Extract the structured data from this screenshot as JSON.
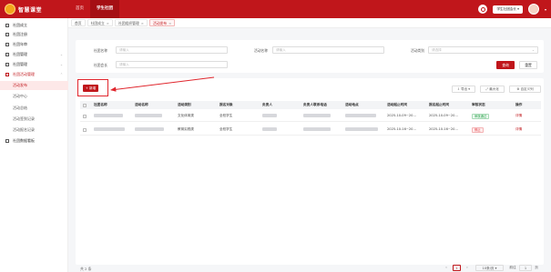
{
  "header": {
    "logo_text": "智慧课堂",
    "nav": [
      "首页",
      "学生社团"
    ],
    "unit_select": "学生社团会长",
    "colors": {
      "brand": "#c0161b",
      "accent": "#f3a51c"
    }
  },
  "sidebar": {
    "items": [
      {
        "label": "社团成立",
        "icon": "grid-icon"
      },
      {
        "label": "社团注册",
        "icon": "grid-icon"
      },
      {
        "label": "社团年审",
        "icon": "grid-icon"
      },
      {
        "label": "社团管理",
        "icon": "grid-icon"
      },
      {
        "label": "社团管理",
        "icon": "grid-icon"
      },
      {
        "label": "社团活动管理",
        "icon": "grid-icon"
      }
    ],
    "sub_items": [
      "活动发布",
      "活动中心",
      "活动总结",
      "活动签到记录",
      "活动报名记录"
    ],
    "last_item": "社团数据看板"
  },
  "tabs": [
    "首页",
    "社团成立",
    "社团组织管理",
    "活动发布"
  ],
  "filters": {
    "club_name_label": "社团名称",
    "club_name_placeholder": "请输入",
    "activity_name_label": "活动名称",
    "activity_name_placeholder": "请输入",
    "activity_type_label": "活动类别",
    "activity_type_placeholder": "请选择",
    "club_leader_label": "社团会长",
    "club_leader_placeholder": "请输入",
    "query_label": "查询",
    "reset_label": "重置"
  },
  "toolbar": {
    "new_label": "+ 新增",
    "export_label": "导出",
    "fullscreen_label": "最大化",
    "columns_label": "自定义列"
  },
  "table": {
    "columns": [
      "社团名称",
      "活动名称",
      "活动类别",
      "报名对象",
      "负责人",
      "负责人联系电话",
      "活动地点",
      "活动起止时间",
      "报名起止时间",
      "审核状态",
      "操作"
    ],
    "rows": [
      {
        "category": "文化体育类",
        "target": "全校学生",
        "start": "2025-10-09~20...",
        "signup": "2025-10-09~20...",
        "status": "审核通过",
        "action": "详情"
      },
      {
        "category": "教育实践类",
        "target": "全校学生",
        "start": "2025-10-16~20...",
        "signup": "2025-10-16~20...",
        "status": "停止",
        "action": "详情"
      }
    ]
  },
  "pagination": {
    "total": "共 2 条",
    "page": "1",
    "page_size": "10条/页",
    "goto_label": "前往",
    "goto_value": "1",
    "page_suffix": "页"
  }
}
